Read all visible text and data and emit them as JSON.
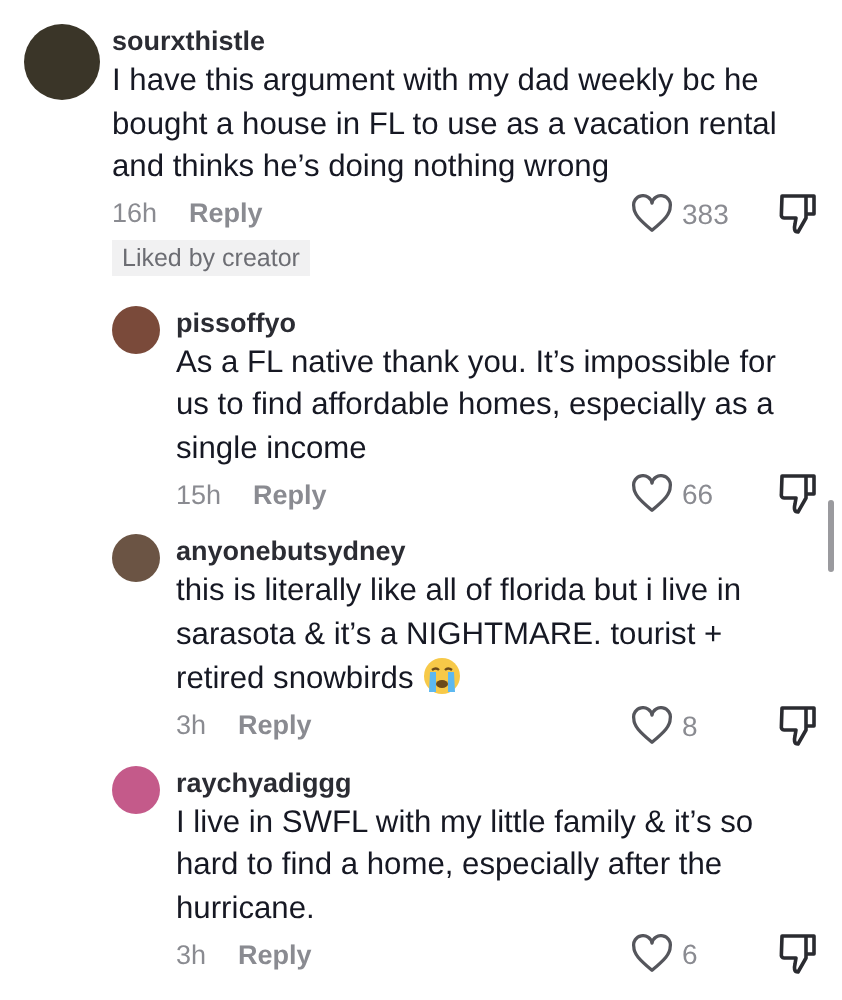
{
  "comments": [
    {
      "username": "sourxthistle",
      "color": "#3a3528",
      "text": "I have this argument with my dad weekly bc he bought a house in FL to use as a vacation rental and thinks he’s doing nothing wrong",
      "time": "16h",
      "reply_label": "Reply",
      "likes": "383",
      "liked": false,
      "badge": "Liked by creator",
      "replies": [
        {
          "username": "pissoffyo",
          "color": "#7a4a3a",
          "kind": "plain",
          "text": "As a FL native thank you. It’s impossible for us to find affordable homes, especially as a single income",
          "time": "15h",
          "reply_label": "Reply",
          "likes": "66",
          "liked": false
        },
        {
          "username": "anyonebutsydney",
          "color": "#6b5444",
          "kind": "emoji",
          "text": "this is literally like all of florida but i live in sarasota & it’s a NIGHTMARE. tourist + retired snowbirds",
          "time": "3h",
          "reply_label": "Reply",
          "likes": "8",
          "liked": false
        },
        {
          "username": "raychyadiggg",
          "color": "#c45a8a",
          "kind": "plain",
          "text": "I live in SWFL with my little family & it’s so hard to find a home, especially after the hurricane.",
          "time": "3h",
          "reply_label": "Reply",
          "likes": "6",
          "liked": false
        }
      ]
    }
  ]
}
